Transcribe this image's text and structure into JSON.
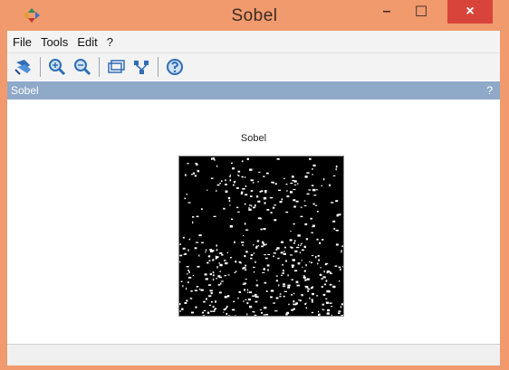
{
  "window": {
    "title": "Sobel",
    "minimize_glyph": "–",
    "maximize_glyph": "☐",
    "close_glyph": "×",
    "titlebar_color": "#f09a6e",
    "close_color": "#d9443a"
  },
  "menu": {
    "items": [
      "File",
      "Tools",
      "Edit",
      "?"
    ]
  },
  "toolbar": {
    "icons": [
      "rotate-icon",
      "zoom-in-icon",
      "zoom-out-icon",
      "window-icon",
      "network-icon",
      "help-icon"
    ]
  },
  "panel": {
    "title": "Sobel",
    "help_glyph": "?",
    "header_color": "#8fa9c9"
  },
  "figure": {
    "title": "Sobel",
    "image_description_icon": "sobel-edge-image"
  }
}
